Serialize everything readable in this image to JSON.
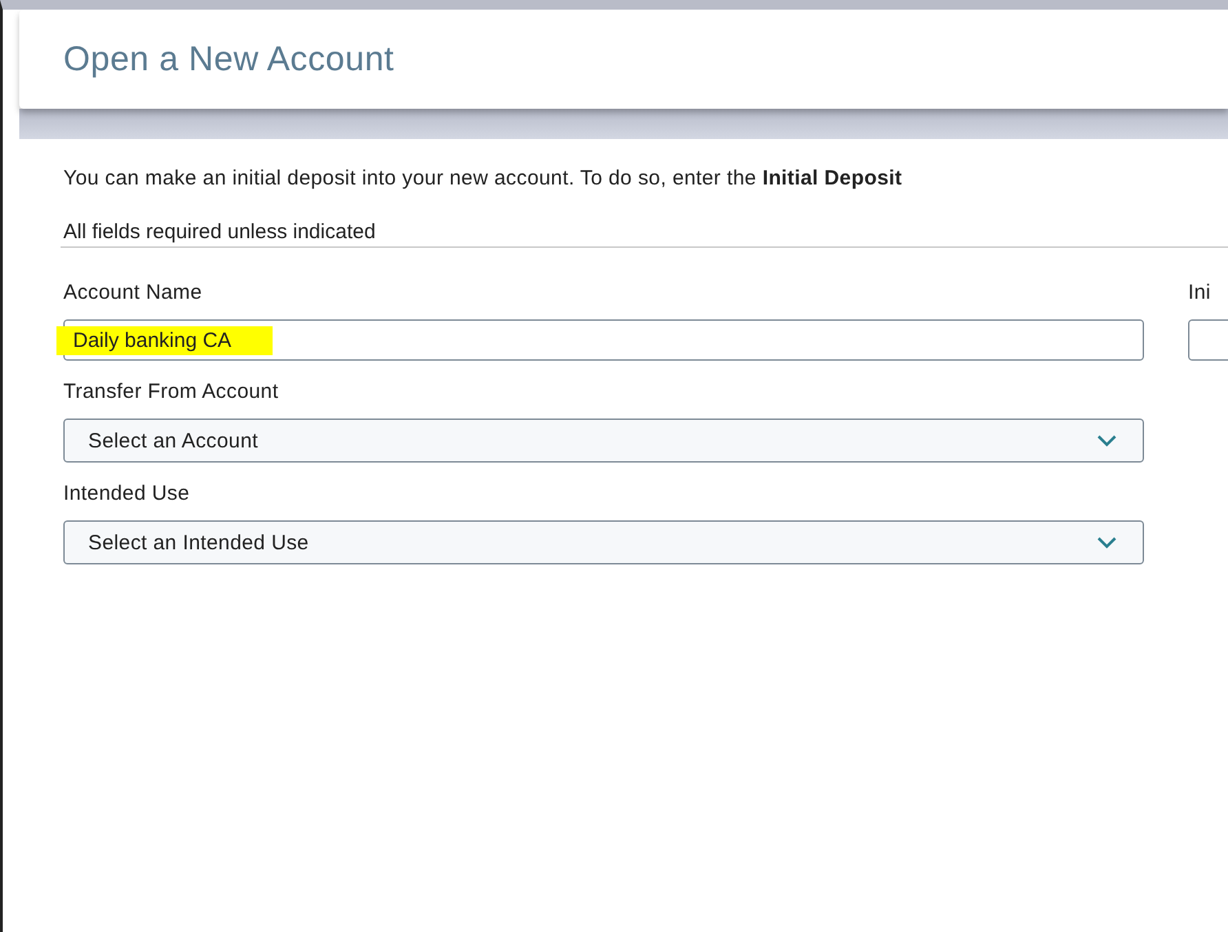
{
  "header": {
    "title": "Open a New Account"
  },
  "intro": "You can make an initial deposit into your new account. To do so, enter the **Initial Deposit**",
  "required_note": "All fields required unless indicated",
  "account_name": {
    "label": "Account Name",
    "value": "Daily banking CA",
    "highlighted": true
  },
  "column_2": {
    "label": "Ini"
  },
  "selects": [
    {
      "label": "Transfer From Account",
      "placeholder": "Select an Account"
    },
    {
      "label": "Intended Use",
      "placeholder": "Select an Intended Use"
    }
  ]
}
